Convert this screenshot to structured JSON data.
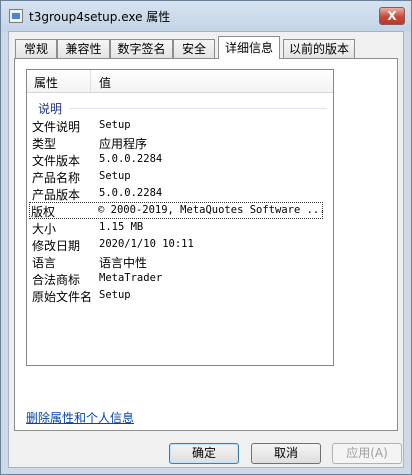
{
  "window": {
    "title": "t3group4setup.exe 属性",
    "close_glyph": "X"
  },
  "tabs": [
    {
      "label": "常规"
    },
    {
      "label": "兼容性"
    },
    {
      "label": "数字签名"
    },
    {
      "label": "安全"
    },
    {
      "label": "详细信息",
      "active": true
    },
    {
      "label": "以前的版本"
    }
  ],
  "details": {
    "columns": {
      "property": "属性",
      "value": "值"
    },
    "group": "说明",
    "rows": [
      {
        "key": "文件说明",
        "value": "Setup"
      },
      {
        "key": "类型",
        "value": "应用程序"
      },
      {
        "key": "文件版本",
        "value": "5.0.0.2284"
      },
      {
        "key": "产品名称",
        "value": "Setup"
      },
      {
        "key": "产品版本",
        "value": "5.0.0.2284"
      },
      {
        "key": "版权",
        "value": "© 2000-2019, MetaQuotes Software ..."
      },
      {
        "key": "大小",
        "value": "1.15 MB"
      },
      {
        "key": "修改日期",
        "value": "2020/1/10 10:11"
      },
      {
        "key": "语言",
        "value": "语言中性"
      },
      {
        "key": "合法商标",
        "value": "MetaTrader"
      },
      {
        "key": "原始文件名",
        "value": "Setup"
      }
    ]
  },
  "link": {
    "label": "删除属性和个人信息"
  },
  "buttons": {
    "ok": "确定",
    "cancel": "取消",
    "apply": "应用(A)"
  },
  "colors": {
    "link": "#0645ad",
    "group_header": "#1e3287"
  }
}
